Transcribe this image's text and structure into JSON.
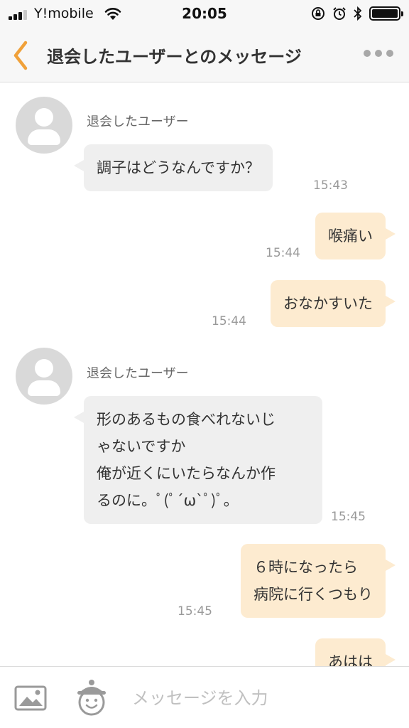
{
  "status_bar": {
    "carrier": "Y!mobile",
    "time": "20:05",
    "battery_level": 1.0
  },
  "nav": {
    "title": "退会したユーザーとのメッセージ"
  },
  "colors": {
    "accent": "#f0a13a",
    "incoming_bubble": "#efefef",
    "outgoing_bubble": "#fdebd0"
  },
  "messages": [
    {
      "direction": "incoming",
      "sender": "退会したユーザー",
      "lines": [
        "調子はどうなんですか？"
      ],
      "time": "15:43"
    },
    {
      "direction": "outgoing",
      "lines": [
        "喉痛い"
      ],
      "time": "15:44"
    },
    {
      "direction": "outgoing",
      "lines": [
        "おなかすいた"
      ],
      "time": "15:44"
    },
    {
      "direction": "incoming",
      "sender": "退会したユーザー",
      "lines": [
        "形のあるもの食べれないじ",
        "ゃないですか",
        "俺が近くにいたらなんか作",
        "るのに。ﾟ(ﾟ´ω`ﾟ)ﾟ。"
      ],
      "time": "15:45"
    },
    {
      "direction": "outgoing",
      "lines": [
        "６時になったら",
        "病院に行くつもり"
      ],
      "time": "15:45"
    },
    {
      "direction": "outgoing",
      "lines": [
        "あはは"
      ],
      "time": ""
    }
  ],
  "input": {
    "placeholder": "メッセージを入力"
  },
  "icons": {
    "back": "chevron-left-icon",
    "more": "more-dots-icon",
    "image": "image-icon",
    "stamp": "stamp-icon",
    "avatar": "default-avatar-icon"
  }
}
